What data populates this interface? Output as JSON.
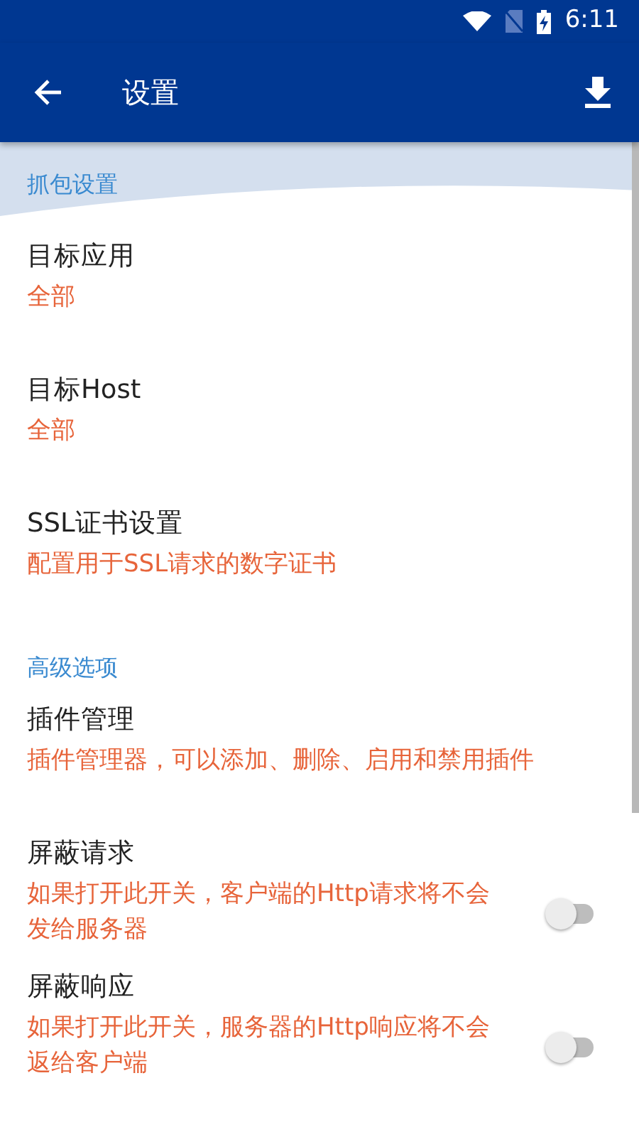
{
  "status_bar": {
    "time": "6:11"
  },
  "app_bar": {
    "title": "设置"
  },
  "sections": [
    {
      "header": "抓包设置",
      "items": [
        {
          "kind": "nav",
          "title": "目标应用",
          "summary": "全部"
        },
        {
          "kind": "nav",
          "title": "目标Host",
          "summary": "全部"
        },
        {
          "kind": "nav",
          "title": "SSL证书设置",
          "summary": "配置用于SSL请求的数字证书"
        }
      ]
    },
    {
      "header": "高级选项",
      "items": [
        {
          "kind": "nav",
          "title": "插件管理",
          "summary": "插件管理器，可以添加、删除、启用和禁用插件"
        },
        {
          "kind": "switch",
          "title": "屏蔽请求",
          "summary": "如果打开此开关，客户端的Http请求将不会发给服务器",
          "on": false
        },
        {
          "kind": "switch",
          "title": "屏蔽响应",
          "summary": "如果打开此开关，服务器的Http响应将不会返给客户端",
          "on": false
        }
      ]
    }
  ]
}
